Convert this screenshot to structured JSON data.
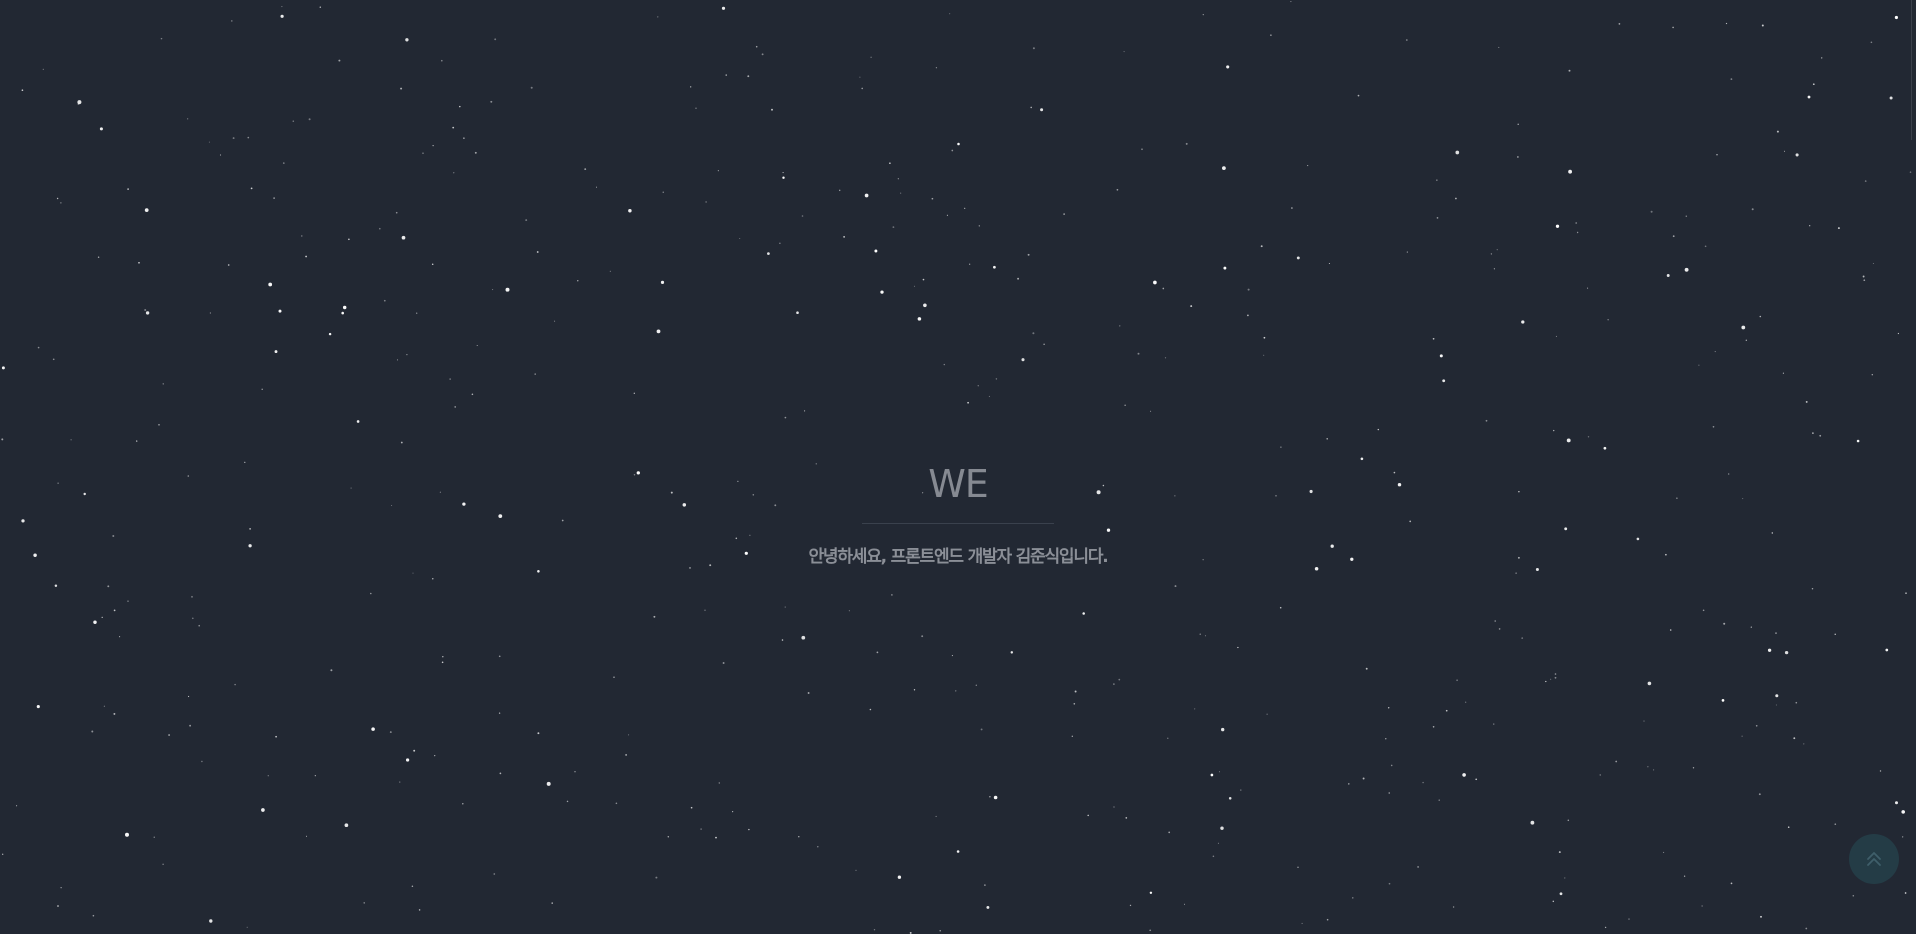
{
  "page": {
    "background_color": "#222833",
    "star_color": "#ffffff"
  },
  "hero": {
    "title": "WE",
    "subtitle": "안녕하세요, 프론트엔드 개발자 김준식입니다."
  },
  "scroll_top_button": {
    "icon": "double-chevron-up-icon",
    "color": "#243c46"
  }
}
